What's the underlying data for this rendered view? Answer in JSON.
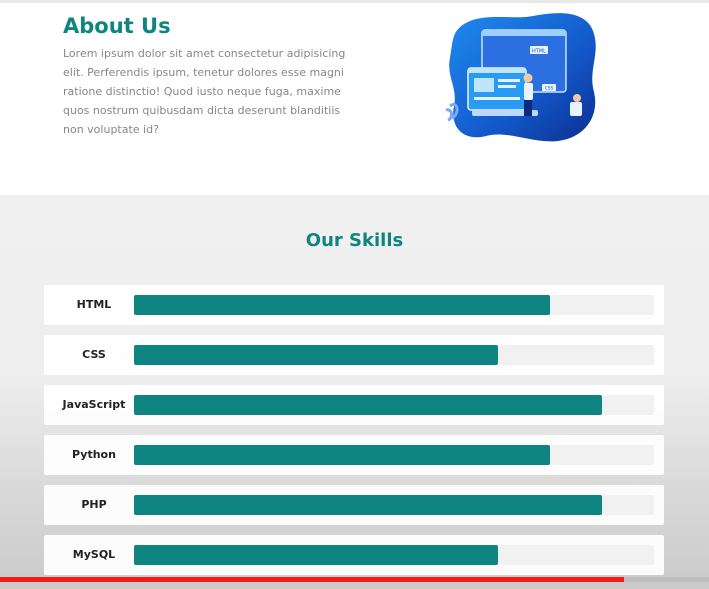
{
  "about": {
    "title": "About Us",
    "text": "Lorem ipsum dolor sit amet consectetur adipisicing elit. Perferendis ipsum, tenetur dolores esse magni ratione distinctio! Quod iusto neque fuga, maxime quos nostrum quibusdam dicta deserunt blanditiis non voluptate id?",
    "illustration_labels": {
      "html": "HTML",
      "css": "CSS"
    }
  },
  "skills": {
    "title": "Our Skills",
    "bar_color": "#0e8581",
    "track_color": "#f1f1f1",
    "items": [
      {
        "name": "HTML",
        "percent": 80
      },
      {
        "name": "CSS",
        "percent": 70
      },
      {
        "name": "JavaScript",
        "percent": 90
      },
      {
        "name": "Python",
        "percent": 80
      },
      {
        "name": "PHP",
        "percent": 90
      },
      {
        "name": "MySQL",
        "percent": 70
      }
    ]
  },
  "video": {
    "progress_percent": 88,
    "progress_color": "#ee1b1b"
  },
  "icons": {
    "settings": "gear-icon"
  },
  "colors": {
    "accent": "#0e8581",
    "body_text": "#878787"
  }
}
